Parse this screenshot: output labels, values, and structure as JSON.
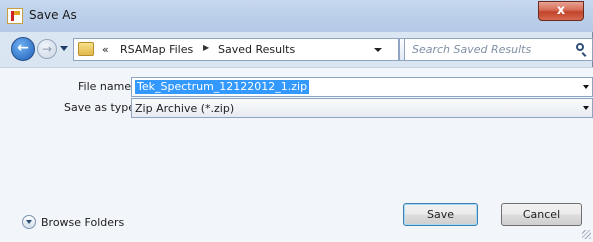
{
  "window": {
    "title": "Save As",
    "close_label": "x"
  },
  "nav": {
    "back_icon": "back-arrow-icon",
    "forward_icon": "forward-arrow-icon",
    "breadcrumb_chevron": "«",
    "breadcrumb": [
      "RSAMap Files",
      "Saved Results"
    ],
    "separator": "▶",
    "refresh_glyph": "↻",
    "search_placeholder": "Search Saved Results"
  },
  "form": {
    "file_name_label": "File name:",
    "file_name_value": "Tek_Spectrum_12122012_1.zip",
    "save_type_label": "Save as type:",
    "save_type_value": "Zip Archive (*.zip)"
  },
  "footer": {
    "browse_folders_label": "Browse Folders",
    "save_label": "Save",
    "cancel_label": "Cancel"
  },
  "colors": {
    "accent": "#3399ff",
    "titlebar": "#bcd0ea",
    "close": "#c2432c"
  }
}
